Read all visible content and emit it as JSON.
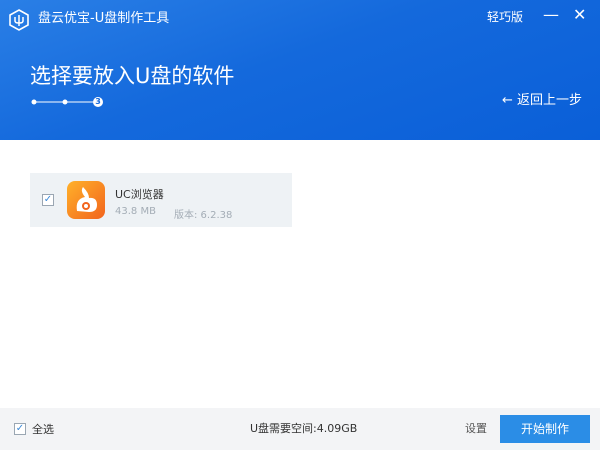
{
  "window": {
    "title": "盘云优宝-U盘制作工具",
    "edition": "轻巧版",
    "minimize": "—",
    "close": "✕"
  },
  "header": {
    "page_title": "选择要放入U盘的软件",
    "current_step": "3",
    "back_label": "返回上一步",
    "back_icon": "←"
  },
  "software": [
    {
      "name": "UC浏览器",
      "size": "43.8 MB",
      "version": "版本: 6.2.38",
      "checked": true,
      "icon": "uc-browser-icon"
    }
  ],
  "footer": {
    "select_all": "全选",
    "required_space": "U盘需要空间:4.09GB",
    "settings": "设置",
    "start": "开始制作"
  },
  "colors": {
    "header": "#1469dc",
    "primary_button": "#2b8de6",
    "footer_bg": "#f3f4f6"
  }
}
